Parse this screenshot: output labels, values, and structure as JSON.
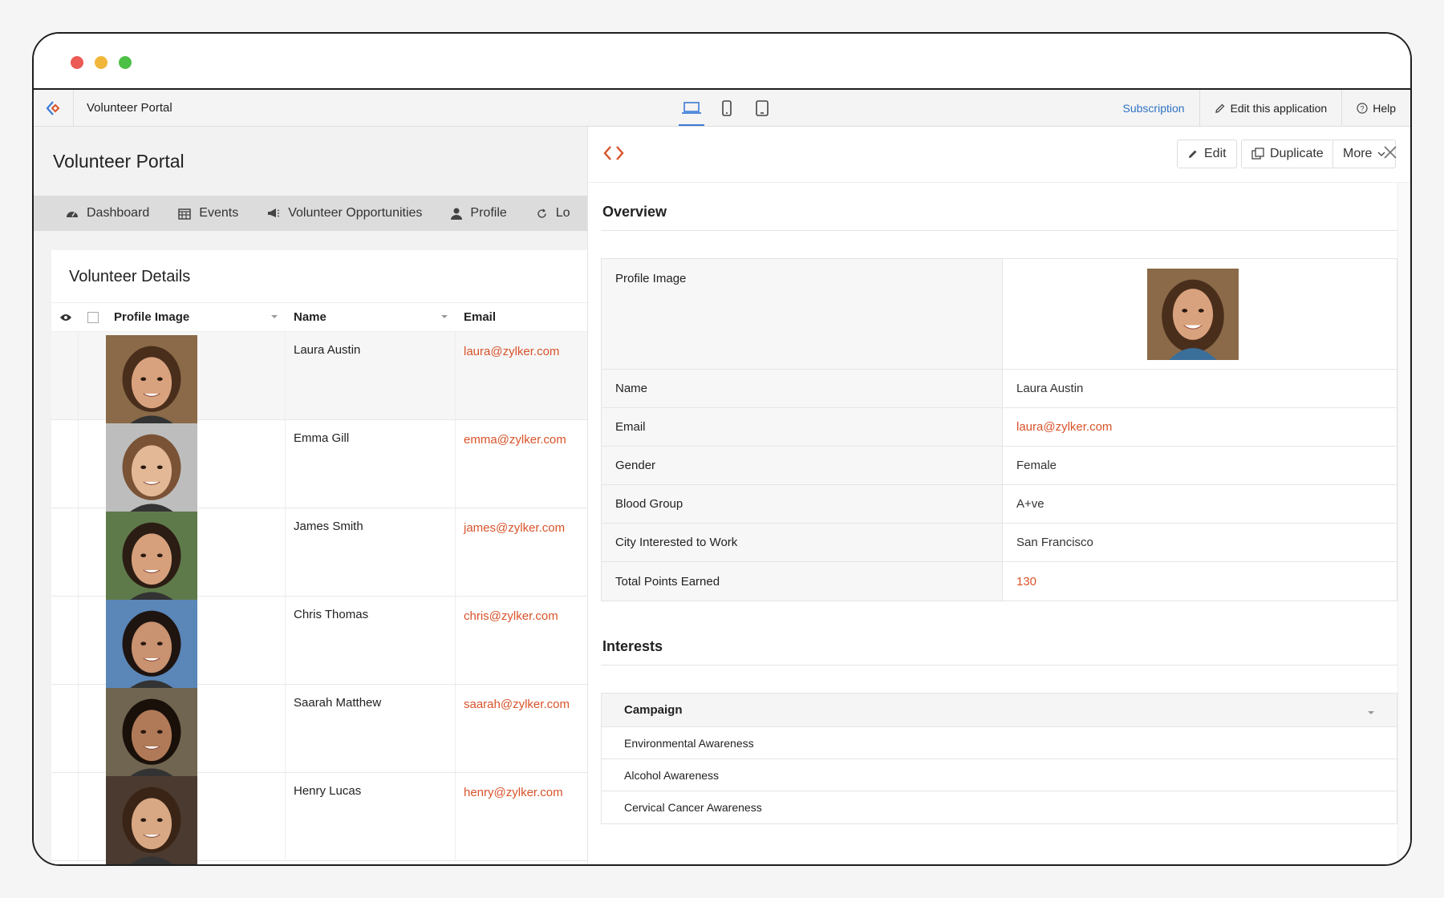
{
  "app": {
    "title": "Volunteer Portal"
  },
  "appbar": {
    "subscription": "Subscription",
    "edit_app": "Edit this application",
    "help": "Help"
  },
  "portal": {
    "title": "Volunteer Portal",
    "nav": [
      "Dashboard",
      "Events",
      "Volunteer Opportunities",
      "Profile",
      "Lo"
    ]
  },
  "list": {
    "title": "Volunteer Details",
    "columns": {
      "image": "Profile Image",
      "name": "Name",
      "email": "Email"
    },
    "rows": [
      {
        "name": "Laura Austin",
        "email": "laura@zylker.com",
        "skin": "#d9a27e",
        "hair": "#4a2e1c",
        "bg": "#8a6a48"
      },
      {
        "name": "Emma Gill",
        "email": "emma@zylker.com",
        "skin": "#e3b896",
        "hair": "#7a5236",
        "bg": "#bdbdbd"
      },
      {
        "name": "James Smith",
        "email": "james@zylker.com",
        "skin": "#d6a07c",
        "hair": "#2b1d14",
        "bg": "#5f7a4a"
      },
      {
        "name": "Chris Thomas",
        "email": "chris@zylker.com",
        "skin": "#c99270",
        "hair": "#1e1410",
        "bg": "#5a86b8"
      },
      {
        "name": "Saarah Matthew",
        "email": "saarah@zylker.com",
        "skin": "#b07a58",
        "hair": "#1a100a",
        "bg": "#6f6550"
      },
      {
        "name": "Henry Lucas",
        "email": "henry@zylker.com",
        "skin": "#d8a884",
        "hair": "#3a2416",
        "bg": "#4a3a30"
      }
    ]
  },
  "detail": {
    "buttons": {
      "edit": "Edit",
      "duplicate": "Duplicate",
      "more": "More"
    },
    "overview_title": "Overview",
    "fields": {
      "profile_image_label": "Profile Image",
      "name_label": "Name",
      "name_value": "Laura Austin",
      "email_label": "Email",
      "email_value": "laura@zylker.com",
      "gender_label": "Gender",
      "gender_value": "Female",
      "blood_label": "Blood Group",
      "blood_value": "A+ve",
      "city_label": "City Interested to Work",
      "city_value": "San Francisco",
      "points_label": "Total Points Earned",
      "points_value": "130"
    },
    "interests_title": "Interests",
    "interests_header": "Campaign",
    "interests": [
      "Environmental Awareness",
      "Alcohol Awareness",
      "Cervical Cancer Awareness"
    ]
  },
  "colors": {
    "accent": "#d8532a",
    "link_blue": "#2f72c4",
    "active_device": "#3a7bd5"
  }
}
